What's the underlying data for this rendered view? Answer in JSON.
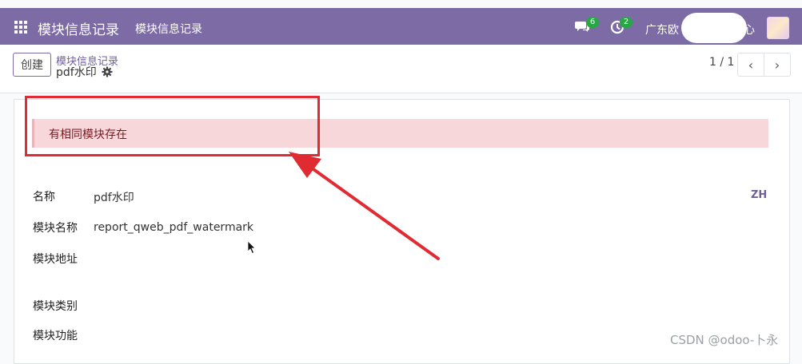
{
  "navbar": {
    "app_title": "模块信息记录",
    "menu_item": "模块信息记录",
    "chat_count": "6",
    "activity_count": "2",
    "company_name_start": "广东欧",
    "company_name_end": "心"
  },
  "control": {
    "create_label": "创建",
    "breadcrumb_parent": "模块信息记录",
    "breadcrumb_current": "pdf水印",
    "pager_value": "1 / 1",
    "prev_symbol": "‹",
    "next_symbol": "›"
  },
  "alert": {
    "message": "有相同模块存在"
  },
  "form": {
    "fields": [
      {
        "label": "名称",
        "value": "pdf水印"
      },
      {
        "label": "模块名称",
        "value": "report_qweb_pdf_watermark"
      },
      {
        "label": "模块地址",
        "value": ""
      },
      {
        "label": "模块类别",
        "value": ""
      },
      {
        "label": "模块功能",
        "value": ""
      }
    ],
    "lang_label": "ZH"
  },
  "watermark": "CSDN @odoo-卜永",
  "colors": {
    "navbar": "#7c6ba5",
    "alert_bg": "#f8d7da",
    "annotation": "#e02b33",
    "badge": "#28a745"
  },
  "icons": [
    "apps-icon",
    "chat-icon",
    "clock-icon",
    "gear-icon",
    "chevron-left-icon",
    "chevron-right-icon",
    "cursor-icon"
  ]
}
